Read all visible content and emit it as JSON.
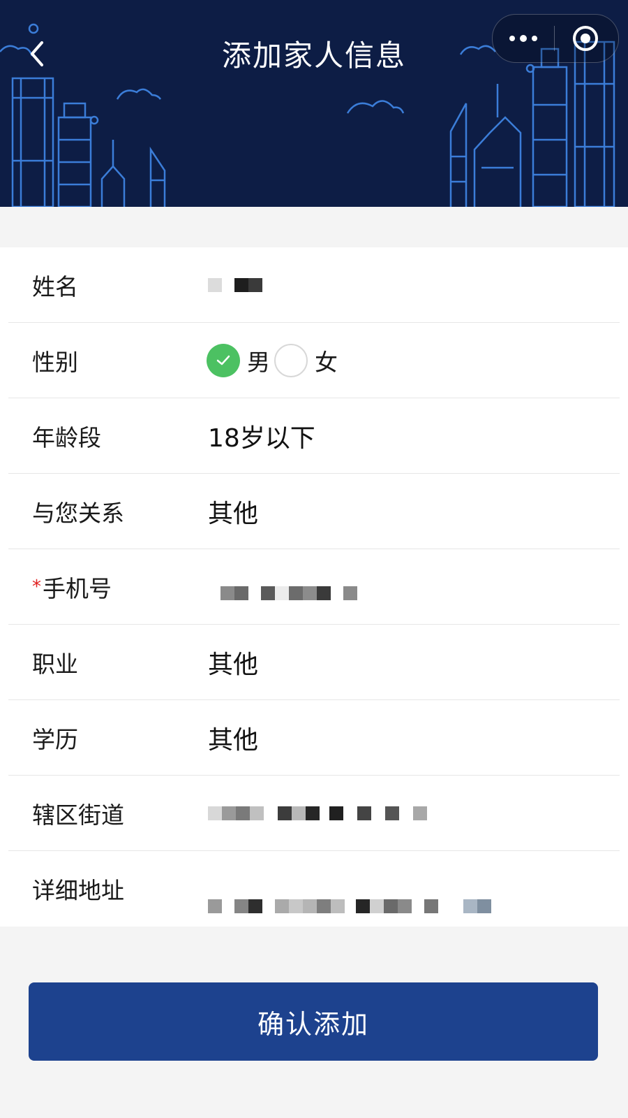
{
  "header": {
    "title": "添加家人信息",
    "back_icon": "chevron-left-icon",
    "more_icon": "more-dots-icon",
    "close_icon": "target-circle-icon",
    "background_color": "#0d1d45",
    "skyline_color": "#3b7dd8"
  },
  "form": {
    "name": {
      "label": "姓名"
    },
    "gender": {
      "label": "性别",
      "options": [
        {
          "label": "男",
          "selected": true
        },
        {
          "label": "女",
          "selected": false
        }
      ],
      "check_color": "#4cc162"
    },
    "age": {
      "label": "年龄段",
      "value": "18岁以下"
    },
    "relation": {
      "label": "与您关系",
      "value": "其他"
    },
    "phone": {
      "label": "手机号",
      "required_mark": "*"
    },
    "job": {
      "label": "职业",
      "value": "其他"
    },
    "education": {
      "label": "学历",
      "value": "其他"
    },
    "district": {
      "label": "辖区街道"
    },
    "address": {
      "label": "详细地址"
    }
  },
  "confirm_button": {
    "label": "确认添加",
    "color": "#1d428e"
  }
}
